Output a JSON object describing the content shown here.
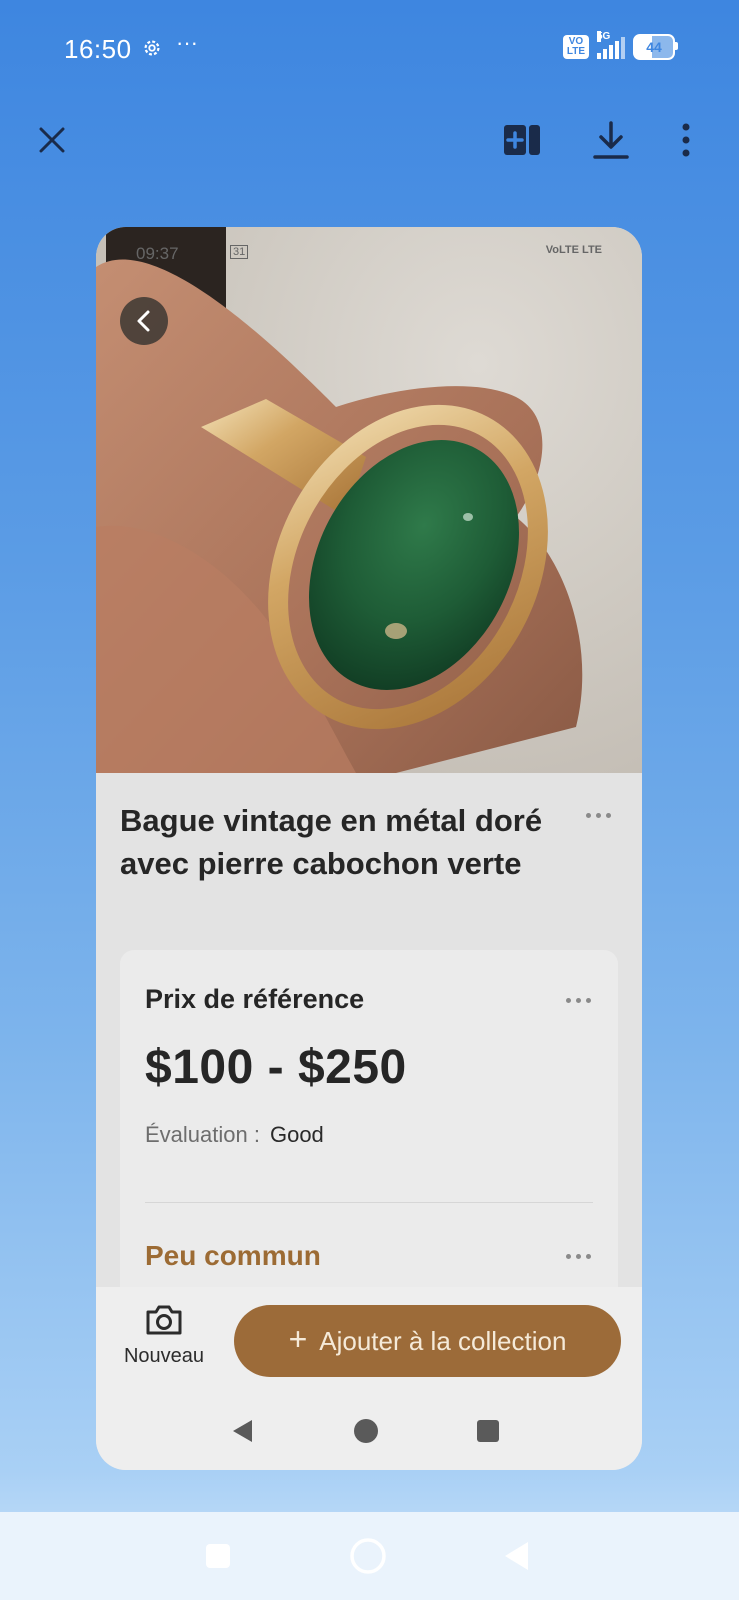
{
  "status_bar": {
    "time": "16:50",
    "network": "5G",
    "volte": "VoLTE",
    "battery": "44"
  },
  "toolbar": {
    "close": "close",
    "compare": "compare",
    "download": "download",
    "more": "more-options"
  },
  "screenshot_card": {
    "inner_status": {
      "time": "09:37",
      "calendar": "31",
      "right": "VoLTE LTE"
    },
    "title": "Bague vintage en métal doré avec pierre cabochon verte",
    "price": {
      "label": "Prix de référence",
      "value": "$100 - $250",
      "evaluation_label": "Évaluation :",
      "evaluation_value": "Good"
    },
    "rarity": "Peu commun",
    "bottom": {
      "new_label": "Nouveau",
      "add_label": "Ajouter à la collection"
    }
  },
  "colors": {
    "accent": "#9c6b39",
    "background_top": "#3e86e0",
    "card": "#e3e3e3"
  }
}
